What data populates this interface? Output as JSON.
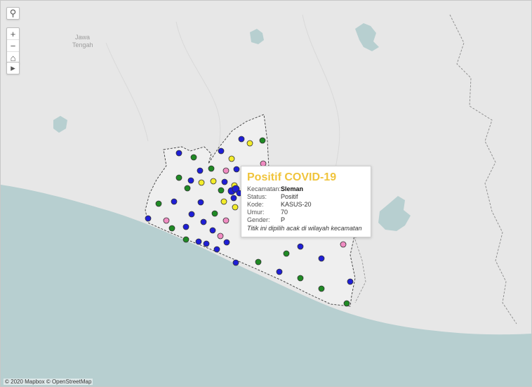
{
  "map": {
    "region_label": [
      "Jawa",
      "Tengah"
    ],
    "attribution": "© 2020 Mapbox © OpenStreetMap",
    "colors": {
      "land": "#e7e7e7",
      "sea": "#b7cfd0",
      "lakes": "#b7cfd0",
      "boundary": "#3a3a3a",
      "region_fill": "#efefef",
      "point_blue": "#1f1fd6",
      "point_green": "#1f8a24",
      "point_yellow": "#f3ec2a",
      "point_pink": "#f08cc2"
    }
  },
  "controls": {
    "search_icon": "search-icon",
    "zoom_in_icon": "plus-icon",
    "zoom_out_icon": "minus-icon",
    "home_icon": "home-icon",
    "expand_icon": "triangle-right-icon",
    "zoom_in": "+",
    "zoom_out": "−",
    "home": "⌂",
    "expand": "▸",
    "search": "⚲"
  },
  "tooltip": {
    "title": "Positif COVID-19",
    "rows": [
      {
        "label": "Kecamatan:",
        "value": "Sleman"
      },
      {
        "label": "Status:",
        "value": "Positif"
      },
      {
        "label": "Kode:",
        "value": "KASUS-20"
      },
      {
        "label": "Umur:",
        "value": "70"
      },
      {
        "label": "Gender:",
        "value": "P"
      }
    ],
    "note": "Titik ini dipilih acak di wilayah kecamatan"
  }
}
